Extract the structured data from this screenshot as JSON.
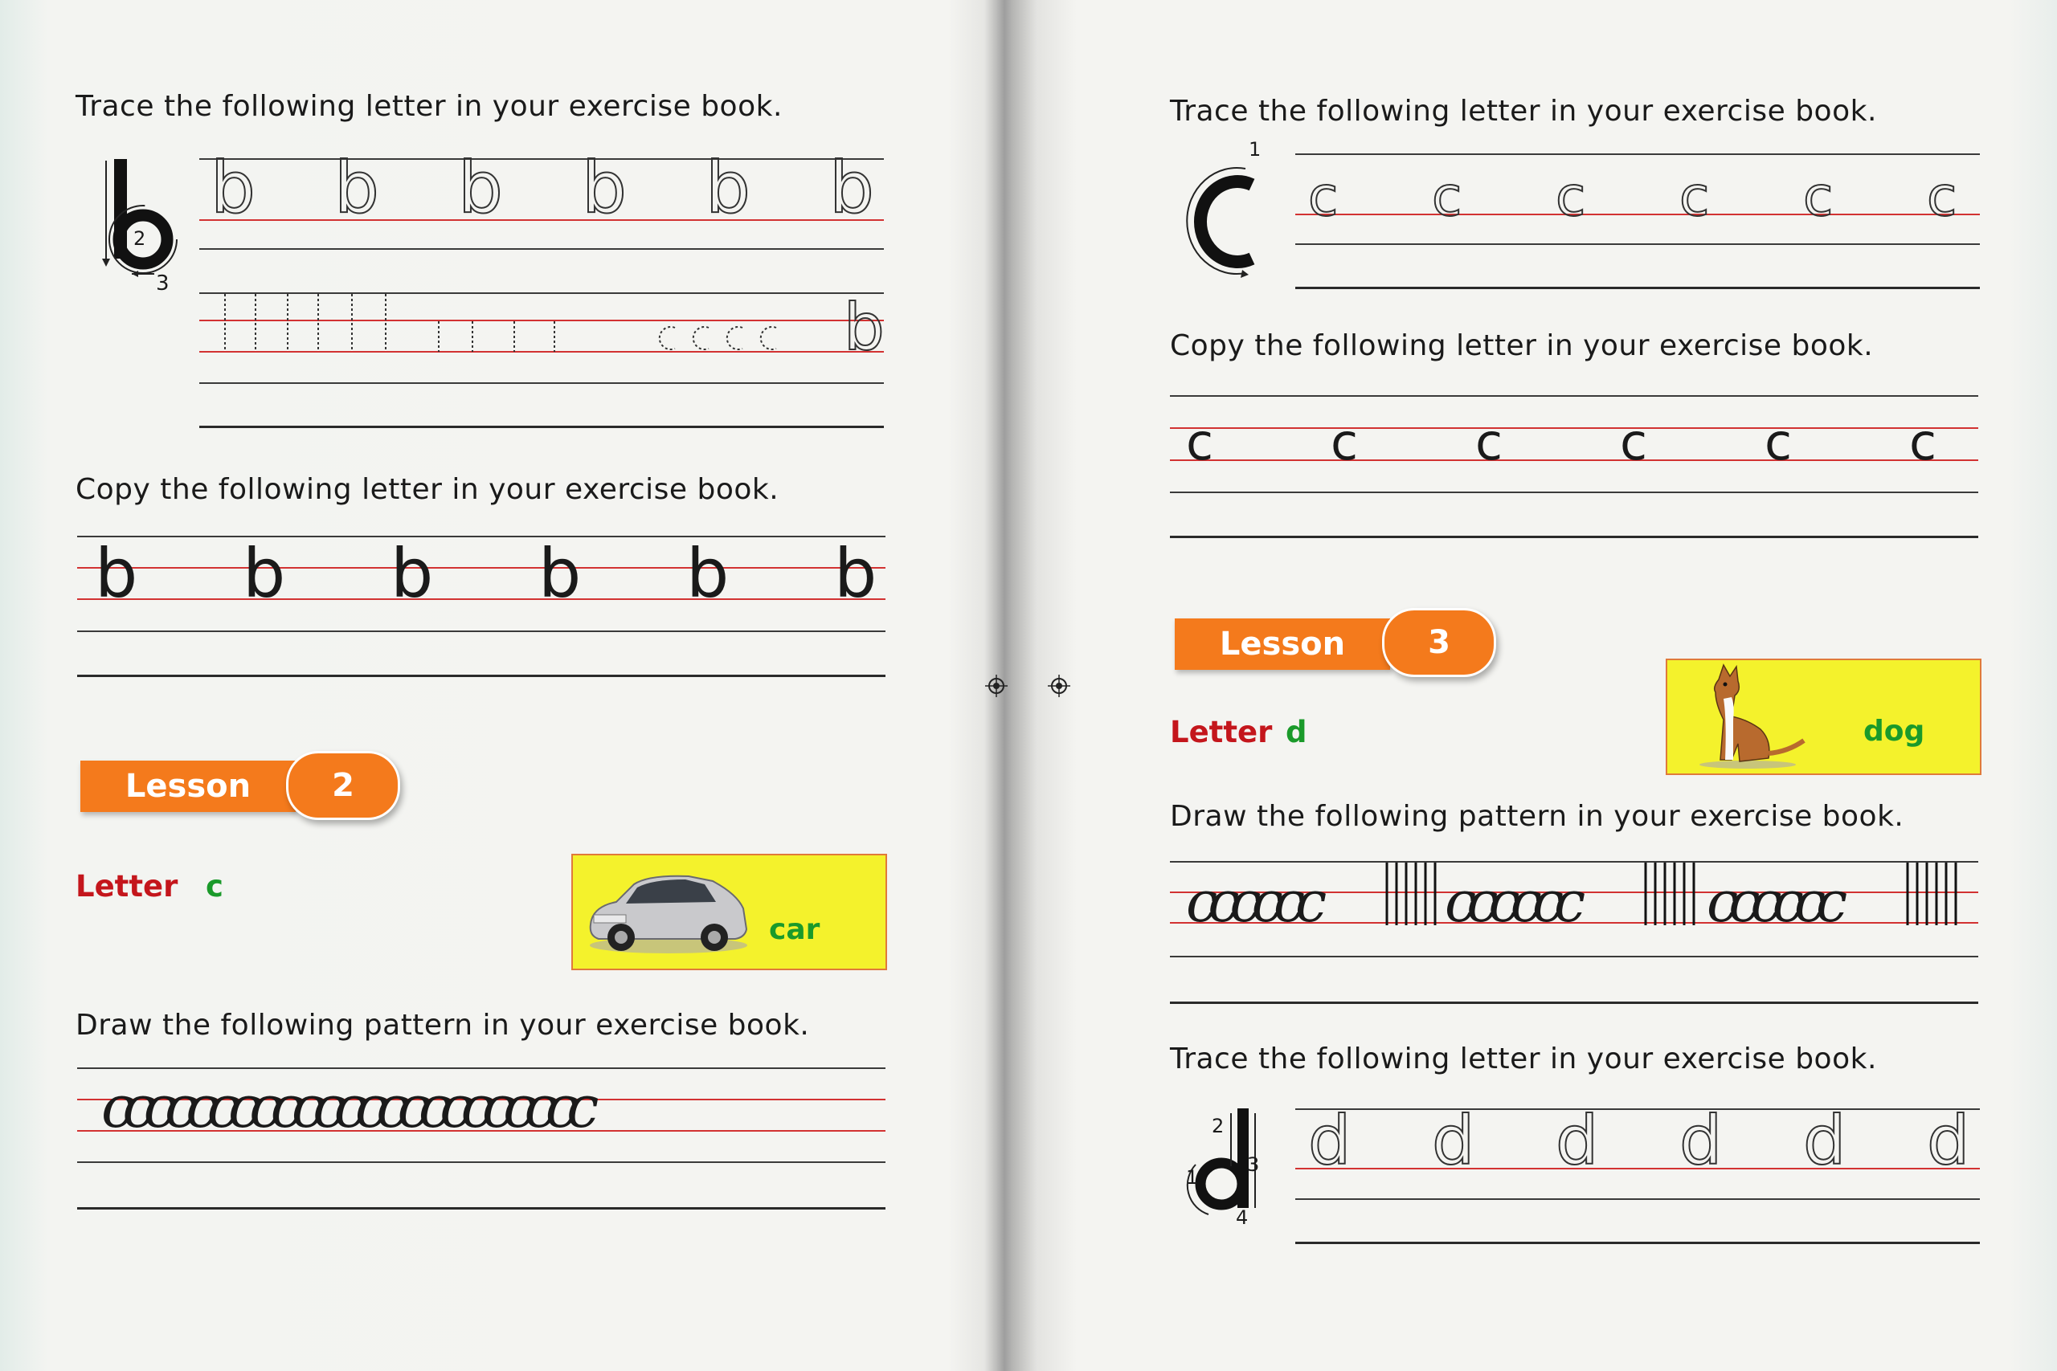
{
  "left_page": {
    "trace_instruction": "Trace the following letter in your exercise book.",
    "trace_letter": "b",
    "trace_stroke_numbers": [
      "2",
      "3"
    ],
    "trace_row": [
      "b",
      "b",
      "b",
      "b",
      "b",
      "b"
    ],
    "pattern_row_end": "b",
    "copy_instruction": "Copy the following letter in your exercise book.",
    "copy_row": [
      "b",
      "b",
      "b",
      "b",
      "b",
      "b"
    ],
    "lesson": {
      "label": "Lesson",
      "number": "2"
    },
    "letter_label": "Letter",
    "letter_value": "c",
    "picture_word": "car",
    "pattern_instruction": "Draw the following pattern in your exercise book.",
    "pattern_text": "ccccccccccccccccccccccc"
  },
  "right_page": {
    "trace_instruction": "Trace the following letter in your exercise book.",
    "trace_letter": "C",
    "trace_stroke_numbers": [
      "1"
    ],
    "trace_row": [
      "c",
      "c",
      "c",
      "c",
      "c",
      "c"
    ],
    "copy_instruction": "Copy the following letter in your exercise book.",
    "copy_row": [
      "c",
      "c",
      "c",
      "c",
      "c",
      "c"
    ],
    "lesson": {
      "label": "Lesson",
      "number": "3"
    },
    "letter_label": "Letter",
    "letter_value": "d",
    "picture_word": "dog",
    "pattern_instruction": "Draw the following pattern in your exercise book.",
    "pattern_groups": [
      "cccccc",
      "cccccc",
      "cccccc"
    ],
    "trace2_instruction": "Trace the following letter in your exercise book.",
    "trace2_letter": "d",
    "trace2_stroke_numbers": [
      "1",
      "2",
      "3",
      "4"
    ],
    "trace2_row": [
      "d",
      "d",
      "d",
      "d",
      "d",
      "d"
    ]
  },
  "colors": {
    "accent_orange": "#f47a1c",
    "label_red": "#c4161c",
    "letter_green": "#1a9a2a",
    "picture_yellow": "#f4f22c",
    "guide_red": "#d23232"
  }
}
